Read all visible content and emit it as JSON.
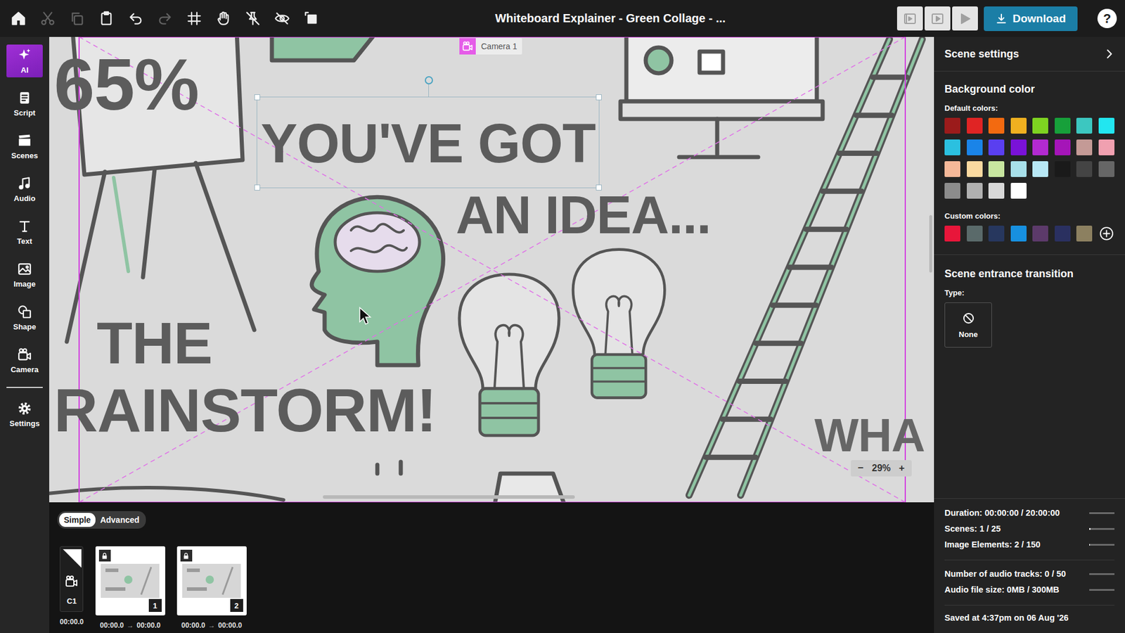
{
  "window": {
    "title": "Whiteboard Explainer - Green Collage - ..."
  },
  "toolbar": [
    {
      "kind": "home",
      "disabled": false
    },
    {
      "kind": "cut",
      "disabled": true
    },
    {
      "kind": "copy",
      "disabled": true
    },
    {
      "kind": "paste",
      "disabled": false
    },
    {
      "kind": "undo",
      "disabled": false
    },
    {
      "kind": "redo",
      "disabled": true
    },
    {
      "kind": "grid",
      "disabled": false
    },
    {
      "kind": "hand",
      "disabled": false
    },
    {
      "kind": "unpin",
      "disabled": false
    },
    {
      "kind": "hide",
      "disabled": false
    },
    {
      "kind": "crop",
      "disabled": false
    }
  ],
  "preview_buttons": [
    {
      "kind": "preview-scene",
      "disabled": true
    },
    {
      "kind": "play-scene",
      "disabled": true
    },
    {
      "kind": "play",
      "disabled": true
    }
  ],
  "download": {
    "label": "Download"
  },
  "help": {
    "label": "?"
  },
  "sidebar": {
    "items": [
      {
        "label": "AI",
        "kind": "ai",
        "selected": true
      },
      {
        "label": "Script",
        "kind": "script",
        "selected": false
      },
      {
        "label": "Scenes",
        "kind": "scenes",
        "selected": false
      },
      {
        "label": "Audio",
        "kind": "audio",
        "selected": false
      },
      {
        "label": "Text",
        "kind": "text",
        "selected": false
      },
      {
        "label": "Image",
        "kind": "image",
        "selected": false
      },
      {
        "label": "Shape",
        "kind": "shape",
        "selected": false
      },
      {
        "label": "Camera",
        "kind": "camera",
        "selected": false
      }
    ],
    "footer": {
      "label": "Settings",
      "kind": "settings",
      "selected": false
    }
  },
  "canvas": {
    "camera_label": "Camera 1",
    "texts": [
      {
        "text": "65%",
        "selected": false
      },
      {
        "text": "YOU'VE GOT",
        "selected": true
      },
      {
        "text": "AN IDEA...",
        "selected": false
      },
      {
        "text": "THE",
        "selected": false
      },
      {
        "text": "RAINSTORM!",
        "selected": false
      },
      {
        "text": "WHA",
        "selected": false
      }
    ],
    "zoom": {
      "minus": "−",
      "value": "29%",
      "plus": "+"
    }
  },
  "timeline": {
    "modes": [
      {
        "label": "Simple",
        "selected": true
      },
      {
        "label": "Advanced",
        "selected": false
      }
    ],
    "camera_track": {
      "label": "C1",
      "time": "00:00.0"
    },
    "scenes": [
      {
        "number": "1",
        "locked": true,
        "start": "00:00.0",
        "arrow": "→",
        "end": "00:00.0"
      },
      {
        "number": "2",
        "locked": true,
        "start": "00:00.0",
        "arrow": "→",
        "end": "00:00.0"
      }
    ]
  },
  "panel": {
    "title": "Scene settings",
    "background": {
      "heading": "Background color",
      "default_label": "Default colors:",
      "default_colors": [
        {
          "color": "#9b1b1b"
        },
        {
          "color": "#e02424"
        },
        {
          "color": "#f36a10"
        },
        {
          "color": "#f0b020"
        },
        {
          "color": "#7ed321"
        },
        {
          "color": "#17a03a"
        },
        {
          "color": "#3cc7c0"
        },
        {
          "color": "#22e6f0"
        },
        {
          "color": "#2bc0e0"
        },
        {
          "color": "#1a84e8"
        },
        {
          "color": "#5a3ff0"
        },
        {
          "color": "#7a12d8"
        },
        {
          "color": "#b22ad0"
        },
        {
          "color": "#a515b8"
        },
        {
          "color": "#c49a96"
        },
        {
          "color": "#f0a0b0"
        },
        {
          "color": "#f5b899"
        },
        {
          "color": "#fad9a0"
        },
        {
          "color": "#c8e6a0"
        },
        {
          "color": "#a8e0ea"
        },
        {
          "color": "#b8e8f5"
        },
        {
          "color": "#1a1a1a"
        },
        {
          "color": "#444444"
        },
        {
          "color": "#666666"
        },
        {
          "color": "#8c8c8c"
        },
        {
          "color": "#b0b0b0"
        },
        {
          "color": "#d8d8d8"
        },
        {
          "color": "#ffffff"
        }
      ],
      "custom_label": "Custom colors:",
      "custom_colors": [
        {
          "color": "#e8163a"
        },
        {
          "color": "#5a6a6a"
        },
        {
          "color": "#27375e"
        },
        {
          "color": "#1790e0"
        },
        {
          "color": "#5c3a6a"
        },
        {
          "color": "#2a3060"
        },
        {
          "color": "#8c8060"
        }
      ]
    },
    "transition": {
      "heading": "Scene entrance transition",
      "type_label": "Type:",
      "value": "None"
    },
    "usage": {
      "project": [
        {
          "label": "Duration: 00:00:00 / 20:00:00",
          "level": 0
        },
        {
          "label": "Scenes: 1 / 25",
          "level": 0.04
        },
        {
          "label": "Image Elements: 2 / 150",
          "level": 0.013
        }
      ],
      "audio": [
        {
          "label": "Number of audio tracks: 0 / 50",
          "level": 0
        },
        {
          "label": "Audio file size: 0MB / 300MB",
          "level": 0
        }
      ]
    },
    "saved": "Saved at 4:37pm on 06 Aug '26"
  }
}
